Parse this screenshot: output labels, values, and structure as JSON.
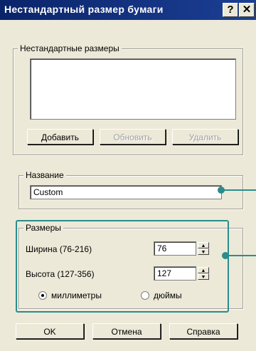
{
  "window": {
    "title": "Нестандартный размер бумаги",
    "help_glyph": "?",
    "close_glyph": "✕"
  },
  "custom_sizes": {
    "group_label": "Нестандартные размеры",
    "items": [],
    "add_label": "Добавить",
    "update_label": "Обновить",
    "delete_label": "Удалить"
  },
  "name_group": {
    "label": "Название",
    "value": "Custom"
  },
  "dimensions": {
    "label": "Размеры",
    "width_label": "Ширина (76-216)",
    "width_value": "76",
    "height_label": "Высота (127-356)",
    "height_value": "127",
    "unit_mm_label": "миллиметры",
    "unit_in_label": "дюймы",
    "selected_unit": "mm"
  },
  "footer": {
    "ok_label": "OK",
    "cancel_label": "Отмена",
    "help_label": "Справка"
  },
  "colors": {
    "annotation": "#2a8c8c",
    "titlebar": "#0a246a"
  }
}
